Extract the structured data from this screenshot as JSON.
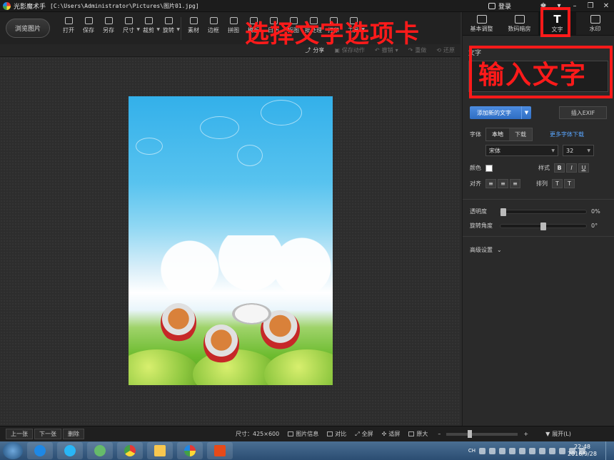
{
  "window": {
    "app_title": "光影魔术手",
    "file_path": "[C:\\Users\\Administrator\\Pictures\\图片01.jpg]",
    "login_label": "登录"
  },
  "toolbar": {
    "browse_label": "浏览图片",
    "tools": [
      {
        "label": "打开",
        "icon": "open-icon"
      },
      {
        "label": "保存",
        "icon": "save-icon"
      },
      {
        "label": "另存",
        "icon": "save-as-icon"
      },
      {
        "label": "尺寸",
        "icon": "resize-icon"
      },
      {
        "label": "裁剪",
        "icon": "crop-icon"
      },
      {
        "label": "旋转",
        "icon": "rotate-icon"
      },
      {
        "label": "素材",
        "icon": "material-icon"
      },
      {
        "label": "边框",
        "icon": "border-icon"
      },
      {
        "label": "拼图",
        "icon": "collage-icon"
      },
      {
        "label": "模板",
        "icon": "template-icon"
      },
      {
        "label": "日历",
        "icon": "calendar-icon"
      },
      {
        "label": "抠图",
        "icon": "cutout-icon"
      },
      {
        "label": "批处理",
        "icon": "batch-icon"
      },
      {
        "label": "打印",
        "icon": "print-icon"
      },
      {
        "label": "工具",
        "icon": "tools-icon"
      }
    ]
  },
  "subbar": {
    "share": "分享",
    "save_action": "保存动作",
    "undo": "撤销",
    "redo": "重做",
    "restore": "还原"
  },
  "right_tabs": [
    {
      "label": "基本调整",
      "icon": "adjust-icon"
    },
    {
      "label": "数码暗房",
      "icon": "darkroom-icon"
    },
    {
      "label": "文字",
      "icon": "text-icon"
    },
    {
      "label": "水印",
      "icon": "watermark-icon"
    }
  ],
  "text_panel": {
    "section_title": "文字",
    "add_text_label": "添加新的文字",
    "insert_exif_label": "插入EXIF",
    "font_label": "字体",
    "font_local": "本地",
    "font_download": "下载",
    "more_fonts": "更多字体下载",
    "font_name": "宋体",
    "font_size": "32",
    "color_label": "颜色",
    "style_label": "样式",
    "bold": "B",
    "italic": "I",
    "underline": "U",
    "align_label": "对齐",
    "arrange_label": "排列",
    "opacity_label": "透明度",
    "opacity_value": "0%",
    "opacity_level": 0,
    "rotation_label": "旋转角度",
    "rotation_value": "0°",
    "rotation_level": 0.5,
    "advanced_label": "高级设置"
  },
  "statusbar": {
    "prev": "上一张",
    "next": "下一张",
    "delete": "删除",
    "size": "尺寸：425×600",
    "info": "图片信息",
    "compare": "对比",
    "fullscreen": "全屏",
    "fit": "适屏",
    "original": "原大",
    "expand": "展开(L)"
  },
  "taskbar": {
    "clock_time": "22:48",
    "clock_date": "2016/9/28",
    "lang": "CH"
  },
  "annotations": {
    "select_tab": "选择文字选项卡",
    "input_text": "输入文字"
  }
}
